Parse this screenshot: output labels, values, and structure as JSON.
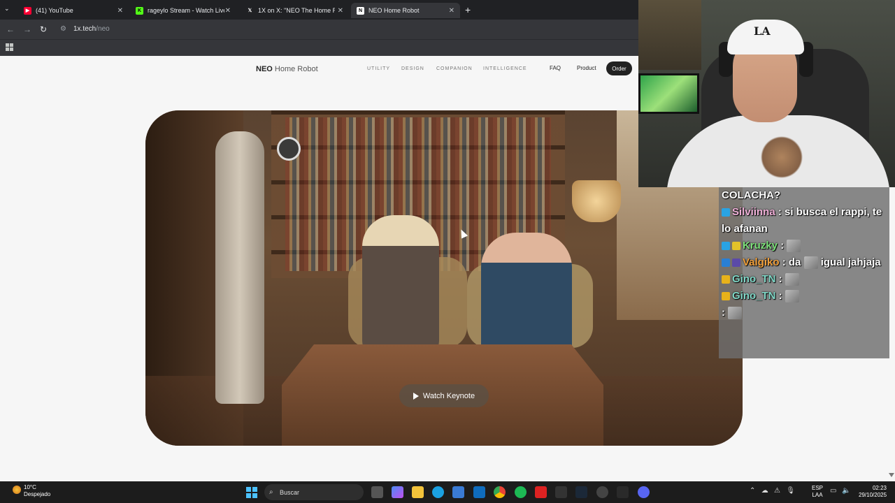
{
  "tabs": [
    {
      "title": "(41) YouTube",
      "favicon": "youtube-icon",
      "color": "#ff0033"
    },
    {
      "title": "rageylo Stream - Watch Live on",
      "favicon": "kick-icon",
      "color": "#53fc18"
    },
    {
      "title": "1X on X: \"NEO The Home Robo",
      "favicon": "x-icon",
      "color": "#000000"
    },
    {
      "title": "NEO Home Robot",
      "favicon": "neo-icon",
      "color": "#ffffff"
    }
  ],
  "address": {
    "domain": "1x.tech",
    "path": "/neo"
  },
  "site": {
    "brand_bold": "NEO",
    "brand_rest": "Home Robot",
    "nav": [
      "UTILITY",
      "DESIGN",
      "COMPANION",
      "INTELLIGENCE"
    ],
    "faq": "FAQ",
    "product": "Product",
    "order": "Order",
    "keynote": "Watch Keynote"
  },
  "chat": {
    "lines": [
      {
        "user": "",
        "text": "COLACHA?"
      },
      {
        "user": "Silviinna",
        "text": ": si busca el rappi, te lo afanan"
      },
      {
        "user": "Kruzky",
        "text": ":"
      },
      {
        "user": "Valgiko",
        "text": ": da",
        "text2": "igual jahjaja"
      },
      {
        "user": "Gino_TN",
        "text": ":"
      },
      {
        "user": "Gino_TN",
        "text": ":"
      },
      {
        "user": "",
        "text": ":"
      }
    ]
  },
  "taskbar": {
    "temp": "10°C",
    "weather": "Despejado",
    "search": "Buscar",
    "lang1": "ESP",
    "lang2": "LAA",
    "time": "02:23",
    "date": "29/10/2025"
  }
}
